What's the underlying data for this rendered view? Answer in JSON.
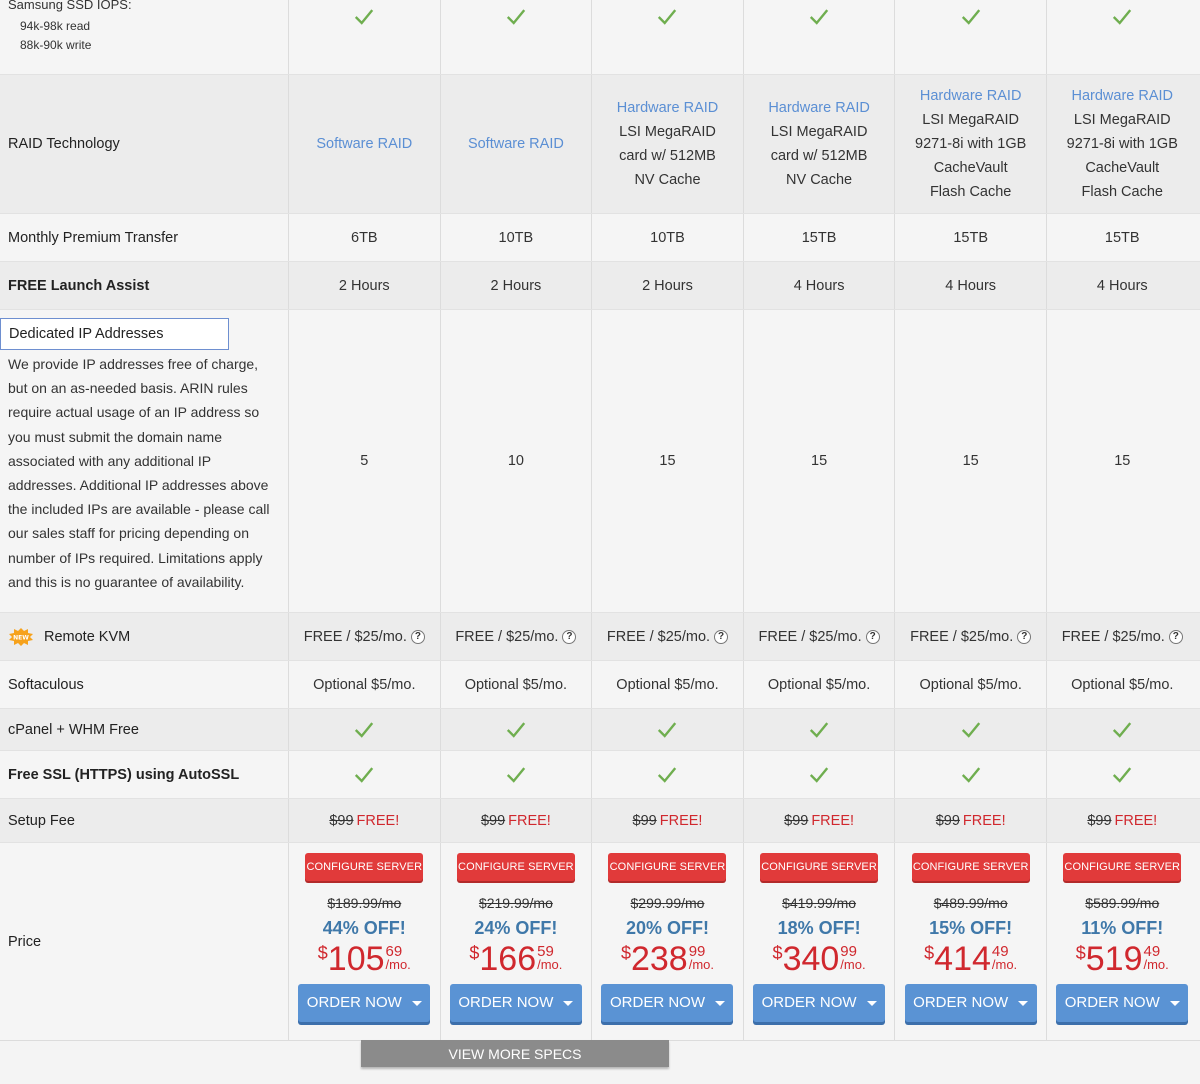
{
  "iops": {
    "title": "Samsung SSD IOPS:",
    "read": "94k-98k read",
    "write": "88k-90k write"
  },
  "raid": {
    "label": "RAID Technology",
    "plans": [
      {
        "link": "Software RAID",
        "lines": []
      },
      {
        "link": "Software RAID",
        "lines": []
      },
      {
        "link": "Hardware RAID",
        "lines": [
          "LSI MegaRAID",
          "card w/ 512MB",
          "NV Cache"
        ]
      },
      {
        "link": "Hardware RAID",
        "lines": [
          "LSI MegaRAID",
          "card w/ 512MB",
          "NV Cache"
        ]
      },
      {
        "link": "Hardware RAID",
        "lines": [
          "LSI MegaRAID",
          "9271-8i with 1GB",
          "CacheVault",
          "Flash Cache"
        ]
      },
      {
        "link": "Hardware RAID",
        "lines": [
          "LSI MegaRAID",
          "9271-8i with 1GB",
          "CacheVault",
          "Flash Cache"
        ]
      }
    ]
  },
  "transfer": {
    "label": "Monthly Premium Transfer",
    "values": [
      "6TB",
      "10TB",
      "10TB",
      "15TB",
      "15TB",
      "15TB"
    ]
  },
  "launch": {
    "label": "FREE Launch Assist",
    "values": [
      "2 Hours",
      "2 Hours",
      "2 Hours",
      "4 Hours",
      "4 Hours",
      "4 Hours"
    ]
  },
  "ip": {
    "label": "Dedicated IP Addresses",
    "description": "We provide IP addresses free of charge, but on an as-needed basis. ARIN rules require actual usage of an IP address so you must submit the domain name associated with any additional IP addresses. Additional IP addresses above the included IPs are available - please call our sales staff for pricing depending on number of IPs required. Limitations apply and this is no guarantee of availability.",
    "values": [
      "5",
      "10",
      "15",
      "15",
      "15",
      "15"
    ]
  },
  "kvm": {
    "badge": "NEW",
    "label": "Remote KVM",
    "value": "FREE / $25/mo.",
    "help": "?"
  },
  "softaculous": {
    "label": "Softaculous",
    "value": "Optional $5/mo."
  },
  "cpanel": {
    "label": "cPanel + WHM Free"
  },
  "ssl": {
    "label": "Free SSL (HTTPS) using AutoSSL"
  },
  "setup": {
    "label": "Setup Fee",
    "old": "$99",
    "free": "FREE!"
  },
  "price": {
    "label": "Price",
    "configure_label": "CONFIGURE SERVER",
    "order_label": "ORDER NOW",
    "dollar": "$",
    "per": "/mo.",
    "plans": [
      {
        "old": "$189.99/mo",
        "off": "44% OFF!",
        "int": "105",
        "cents": "69"
      },
      {
        "old": "$219.99/mo",
        "off": "24% OFF!",
        "int": "166",
        "cents": "59"
      },
      {
        "old": "$299.99/mo",
        "off": "20% OFF!",
        "int": "238",
        "cents": "99"
      },
      {
        "old": "$419.99/mo",
        "off": "18% OFF!",
        "int": "340",
        "cents": "99"
      },
      {
        "old": "$489.99/mo",
        "off": "15% OFF!",
        "int": "414",
        "cents": "49"
      },
      {
        "old": "$589.99/mo",
        "off": "11% OFF!",
        "int": "519",
        "cents": "49"
      }
    ]
  },
  "view_more": "VIEW MORE SPECS",
  "colors": {
    "check": "#6fae4f",
    "link": "#5b8fd4",
    "red": "#d0282e",
    "order": "#5a93d4",
    "configure": "#e13a3a",
    "off": "#3f78a9"
  }
}
